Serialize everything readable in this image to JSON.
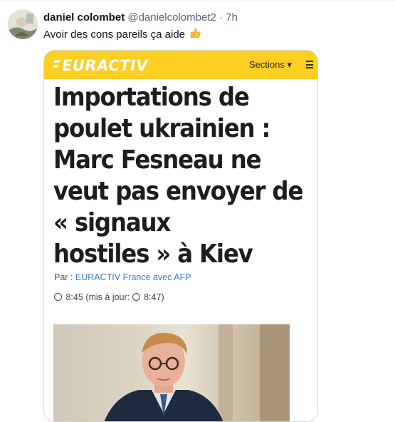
{
  "tweet": {
    "author_name": "daniel colombet",
    "author_handle": "@danielcolombet2",
    "separator": "·",
    "time": "7h",
    "text": "Avoir des cons pareils ça aide",
    "emoji_icon": "thumbs-up-icon"
  },
  "card": {
    "brand": "EURACTIV",
    "sections_label": "Sections ▾",
    "headline_lines": [
      "Importations de",
      "poulet ukrainien :",
      "Marc Fesneau ne",
      "veut pas envoyer de",
      "« signaux",
      "hostiles » à Kiev"
    ],
    "byline_prefix": "Par :",
    "byline_author": "EURACTIV France avec AFP",
    "time_published": "8:45",
    "time_updated_label": "(mis à jour:",
    "time_updated": "8:47)"
  },
  "colors": {
    "header_yellow": "#fdcf22",
    "link_blue": "#3d7cc2",
    "muted_text": "#536471"
  }
}
